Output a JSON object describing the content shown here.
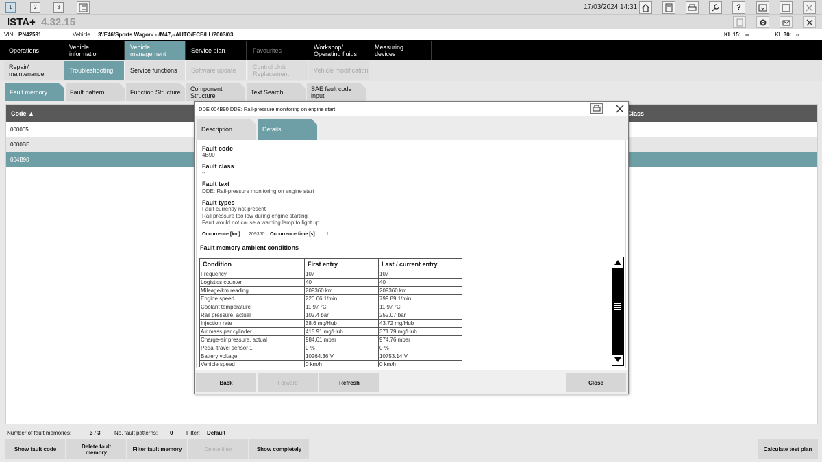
{
  "topbar": {
    "tabs": [
      "1",
      "2",
      "3"
    ],
    "datetime": "17/03/2024 14:31:30"
  },
  "app": {
    "name": "ISTA+",
    "version": "4.32.15"
  },
  "vehicle_line": {
    "vin_label": "VIN",
    "vin": "PN42591",
    "vehicle_label": "Vehicle",
    "vehicle": "3'/E46/Sports Wagon/ - /M47,-/AUTO/ECE/LL/2003/03",
    "kl15_label": "KL 15:",
    "kl15": "--",
    "kl30_label": "KL 30:",
    "kl30": "--"
  },
  "main_nav": [
    {
      "label": "Operations"
    },
    {
      "label": "Vehicle information"
    },
    {
      "label": "Vehicle management"
    },
    {
      "label": "Service plan"
    },
    {
      "label": "Favourites"
    },
    {
      "label": "Workshop/ Operating fluids"
    },
    {
      "label": "Measuring devices"
    }
  ],
  "sub_nav": [
    {
      "label": "Repair/ maintenance"
    },
    {
      "label": "Troubleshooting"
    },
    {
      "label": "Service functions"
    },
    {
      "label": "Software update"
    },
    {
      "label": "Control Unit Replacement"
    },
    {
      "label": "Vehicle modification"
    }
  ],
  "tool_tabs": [
    {
      "label": "Fault memory"
    },
    {
      "label": "Fault pattern"
    },
    {
      "label": "Function Structure"
    },
    {
      "label": "Component Structure"
    },
    {
      "label": "Text Search"
    },
    {
      "label": "SAE fault code input"
    }
  ],
  "fault_list": {
    "code_header": "Code ▲",
    "class_header": "Class",
    "rows": [
      "000005",
      "0000BE",
      "004B90"
    ]
  },
  "bottom": {
    "num_fault_label": "Number of fault memories:",
    "num_fault": "3 / 3",
    "num_pattern_label": "No. fault patterns:",
    "num_pattern": "0",
    "filter_label": "Filter:",
    "filter": "Default",
    "buttons": [
      "Show fault code",
      "Delete fault memory",
      "Filter fault memory",
      "Delete filter",
      "Show completely",
      "Calculate test plan"
    ]
  },
  "dialog": {
    "title": "DDE 004B90 DDE: Rail-pressure monitoring on engine start",
    "tabs": [
      "Description",
      "Details"
    ],
    "fault_code_label": "Fault code",
    "fault_code": "4B90",
    "fault_class_label": "Fault class",
    "fault_class": "--",
    "fault_text_label": "Fault text",
    "fault_text": "DDE: Rail-pressure monitoring on engine start",
    "fault_types_label": "Fault types",
    "fault_types": [
      "Fault currently not present",
      "Rail pressure too low during engine starting",
      "Fault would not cause a warning lamp to light up"
    ],
    "occ_km_label": "Occurrence [km]:",
    "occ_km": "209360",
    "occ_time_label": "Occurrence time [s]:",
    "occ_time": "1",
    "ambient_title": "Fault memory ambient conditions",
    "table_headers": [
      "Condition",
      "First entry",
      "Last / current entry"
    ],
    "table_rows": [
      [
        "Frequency",
        "107",
        "107"
      ],
      [
        "Logistics counter",
        "40",
        "40"
      ],
      [
        "Mileage/km reading",
        "209360 km",
        "209360 km"
      ],
      [
        "Engine speed",
        "220.66 1/min",
        "799.89 1/min"
      ],
      [
        "Coolant temperature",
        "11.97 °C",
        "11.97 °C"
      ],
      [
        "Rail pressure, actual",
        "102.4 bar",
        "252.07 bar"
      ],
      [
        "Injection rate",
        "38.6 mg/Hub",
        "43.72 mg/Hub"
      ],
      [
        "Air mass per cylinder",
        "415.91 mg/Hub",
        "371.79 mg/Hub"
      ],
      [
        "Charge-air pressure, actual",
        "984.61 mbar",
        "974.76 mbar"
      ],
      [
        "Pedal-travel sensor 1",
        "0 %",
        "0 %"
      ],
      [
        "Battery voltage",
        "10264.36 V",
        "10753.14 V"
      ],
      [
        "Vehicle speed",
        "0 km/h",
        "0 km/h"
      ]
    ],
    "buttons": [
      "Back",
      "Forward",
      "Refresh",
      "Close"
    ]
  },
  "colors": {
    "accent": "#6f9fa6",
    "nav_bg": "#000000",
    "header_bg": "#595959"
  }
}
